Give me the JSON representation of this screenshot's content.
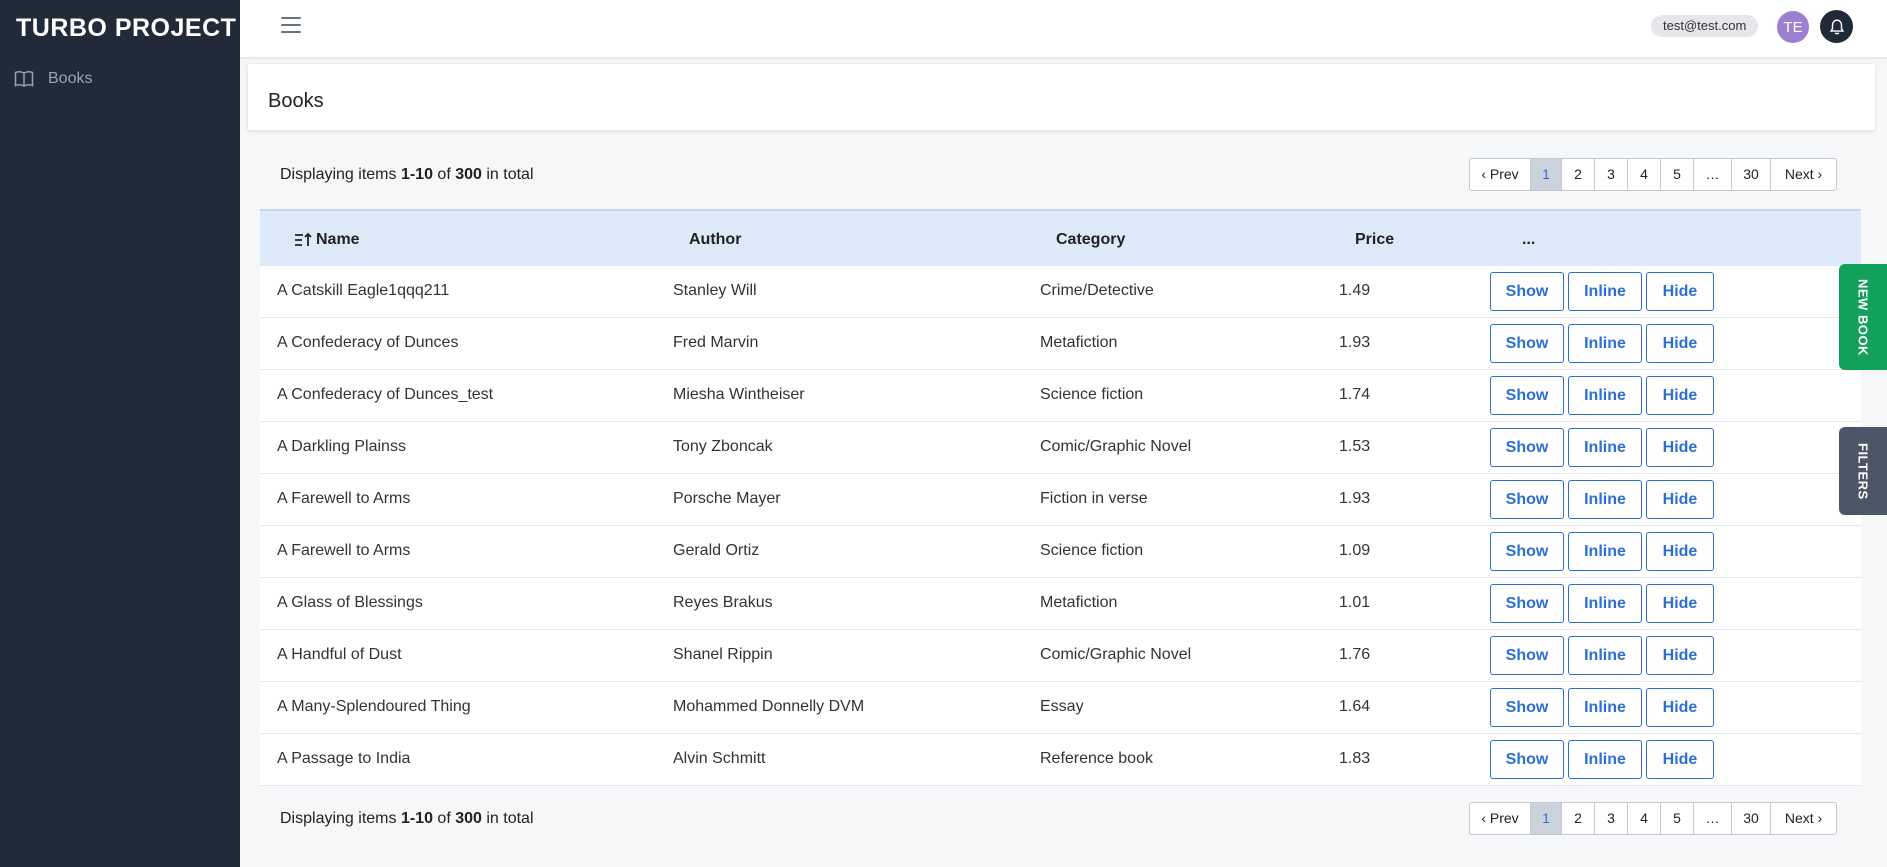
{
  "app": {
    "brand": "TURBO PROJECT",
    "sidebar": {
      "items": [
        {
          "label": "Books",
          "icon": "book-icon"
        }
      ]
    }
  },
  "topbar": {
    "menu_icon": "hamburger-icon",
    "user_email": "test@test.com",
    "avatar_initials": "TE",
    "notification_icon": "bell-icon"
  },
  "page": {
    "title": "Books"
  },
  "summary": {
    "prefix": "Displaying items ",
    "range": "1-10",
    "of": " of ",
    "total": "300",
    "suffix": " in total"
  },
  "pagination": {
    "prev": "‹ Prev",
    "pages": [
      "1",
      "2",
      "3",
      "4",
      "5",
      "…",
      "30"
    ],
    "active": "1",
    "next": "Next ›"
  },
  "table": {
    "columns": {
      "name": "Name",
      "author": "Author",
      "category": "Category",
      "price": "Price",
      "actions": "..."
    },
    "sort_icon": "sort-ascending-icon",
    "actions": {
      "show": "Show",
      "inline": "Inline",
      "hide": "Hide"
    },
    "rows": [
      {
        "name": "A Catskill Eagle1qqq211",
        "author": "Stanley Will",
        "category": "Crime/Detective",
        "price": "1.49"
      },
      {
        "name": "A Confederacy of Dunces",
        "author": "Fred Marvin",
        "category": "Metafiction",
        "price": "1.93"
      },
      {
        "name": "A Confederacy of Dunces_test",
        "author": "Miesha Wintheiser",
        "category": "Science fiction",
        "price": "1.74"
      },
      {
        "name": "A Darkling Plainss",
        "author": "Tony Zboncak",
        "category": "Comic/Graphic Novel",
        "price": "1.53"
      },
      {
        "name": "A Farewell to Arms",
        "author": "Porsche Mayer",
        "category": "Fiction in verse",
        "price": "1.93"
      },
      {
        "name": "A Farewell to Arms",
        "author": "Gerald Ortiz",
        "category": "Science fiction",
        "price": "1.09"
      },
      {
        "name": "A Glass of Blessings",
        "author": "Reyes Brakus",
        "category": "Metafiction",
        "price": "1.01"
      },
      {
        "name": "A Handful of Dust",
        "author": "Shanel Rippin",
        "category": "Comic/Graphic Novel",
        "price": "1.76"
      },
      {
        "name": "A Many-Splendoured Thing",
        "author": "Mohammed Donnelly DVM",
        "category": "Essay",
        "price": "1.64"
      },
      {
        "name": "A Passage to India",
        "author": "Alvin Schmitt",
        "category": "Reference book",
        "price": "1.83"
      }
    ]
  },
  "side_tabs": {
    "new_book": "NEW BOOK",
    "filters": "FILTERS"
  },
  "colors": {
    "sidebar_bg": "#212a39",
    "accent": "#2b6fd6",
    "header_row": "#dde9f8",
    "new_book_tab": "#12a05a",
    "filters_tab": "#4b5565"
  }
}
